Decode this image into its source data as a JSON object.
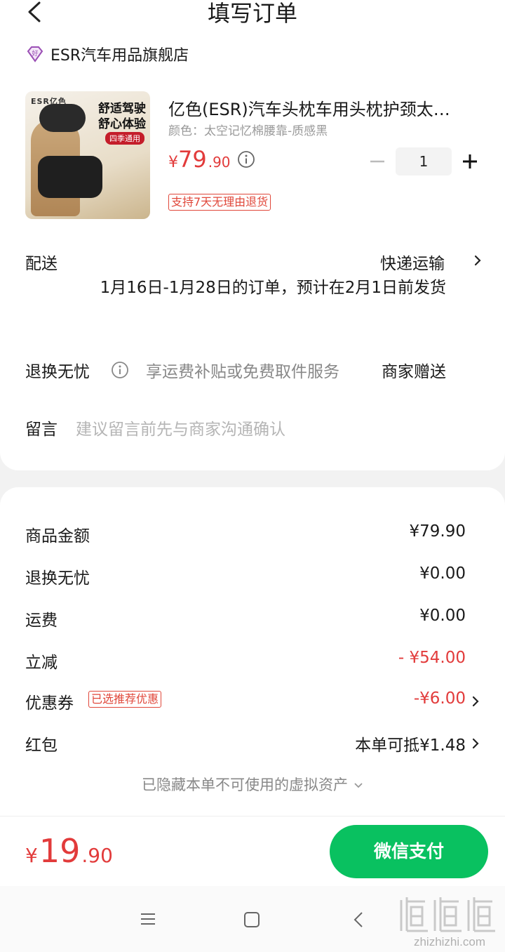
{
  "header": {
    "title": "填写订单"
  },
  "shop": {
    "name": "ESR汽车用品旗舰店"
  },
  "product": {
    "title": "亿色(ESR)汽车头枕车用头枕护颈太…",
    "spec": "颜色：太空记忆棉腰靠-质感黑",
    "price_symbol": "¥",
    "price_int": "79",
    "price_dec": ".90",
    "quantity": "1",
    "return_tag": "支持7天无理由退货",
    "image_text": {
      "brand": "ESR亿色",
      "slogan1": "舒适驾驶",
      "slogan2": "舒心体验",
      "tag": "四季通用"
    }
  },
  "shipping": {
    "label": "配送",
    "method": "快递运输",
    "note": "1月16日-1月28日的订单，预计在2月1日前发货"
  },
  "worry_free": {
    "label": "退换无忧",
    "desc": "享运费补贴或免费取件服务",
    "value": "商家赠送"
  },
  "message": {
    "label": "留言",
    "placeholder": "建议留言前先与商家沟通确认"
  },
  "summary": {
    "goods_amount": {
      "label": "商品金额",
      "value": "¥79.90"
    },
    "worry_free": {
      "label": "退换无忧",
      "value": "¥0.00"
    },
    "freight": {
      "label": "运费",
      "value": "¥0.00"
    },
    "discount": {
      "label": "立减",
      "value": "- ¥54.00"
    },
    "coupon": {
      "label": "优惠券",
      "tag": "已选推荐优惠",
      "value": "-¥6.00"
    },
    "red_packet": {
      "label": "红包",
      "value": "本单可抵¥1.48"
    },
    "hidden_assets": "已隐藏本单不可使用的虚拟资产"
  },
  "pay": {
    "symbol": "¥",
    "total_int": "19",
    "total_dec": ".90",
    "button": "微信支付"
  },
  "watermark": {
    "domain": "zhizhizhi.com"
  },
  "colors": {
    "accent_red": "#e23b3b",
    "pay_green": "#09c160"
  }
}
